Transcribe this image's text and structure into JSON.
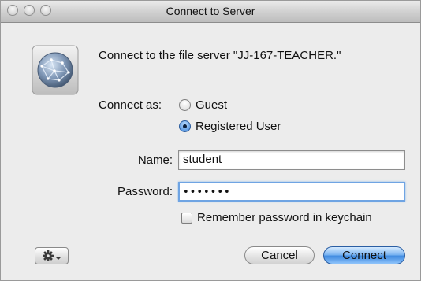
{
  "window": {
    "title": "Connect to Server"
  },
  "icons": {
    "app": "network-globe-icon",
    "close": "close-icon",
    "minimize": "minimize-icon",
    "zoom": "zoom-icon",
    "action": "gear-icon"
  },
  "dialog": {
    "message": "Connect to the file server \"JJ-167-TEACHER.\"",
    "connect_as_label": "Connect as:",
    "options": [
      {
        "label": "Guest",
        "selected": false
      },
      {
        "label": "Registered User",
        "selected": true
      }
    ],
    "name_label": "Name:",
    "name_value": "student",
    "password_label": "Password:",
    "password_mask": "•••••••",
    "remember_label": "Remember password in keychain",
    "remember_checked": false
  },
  "buttons": {
    "cancel": "Cancel",
    "connect": "Connect"
  },
  "colors": {
    "accent": "#3f8ae0",
    "focus_ring": "#6fa4e3",
    "window_bg": "#ececec"
  }
}
